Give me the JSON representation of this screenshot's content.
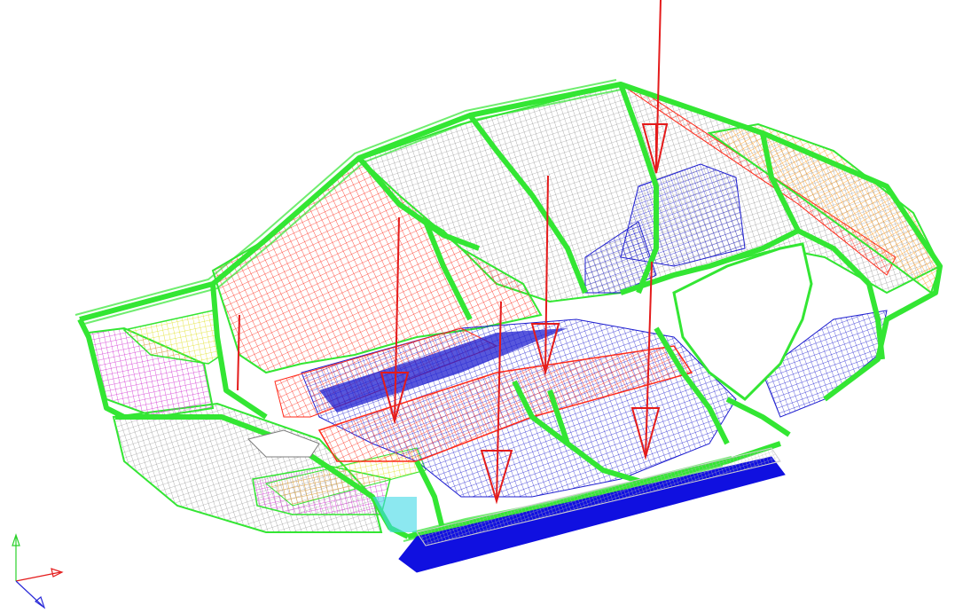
{
  "viewport": {
    "background": "#ffffff",
    "content": "fe-mesh-car-body-in-white",
    "view": "isometric"
  },
  "colors": {
    "green": "#33e633",
    "red": "#ff2a1a",
    "blue": "#1f1fd0",
    "gray": "#7c7c7c",
    "yellow": "#f2f23a",
    "magenta": "#d02ad0",
    "orange": "#ff9a1a",
    "cyan": "#40d8e6",
    "load_arrow": "#e41b1b"
  },
  "triad": {
    "x_axis_color": "#e41b1b",
    "y_axis_color": "#2a2ad8",
    "z_axis_color": "#2bd12b",
    "icon": "axis-triad-icon"
  },
  "load_arrows": {
    "count": 6,
    "color": "#e41b1b",
    "icon": "force-arrow-icon"
  }
}
